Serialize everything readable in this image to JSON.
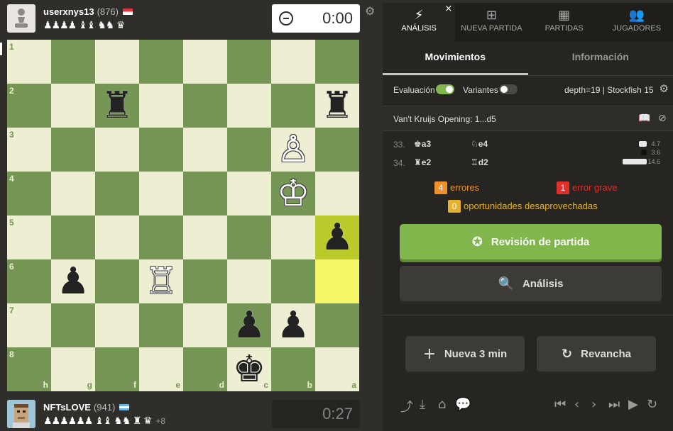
{
  "top_player": {
    "username": "userxnys13",
    "rating": "(876)",
    "country": "Indonesia",
    "captured": "♟♟♟♟ ♝♝ ♞♞ ♛",
    "clock": "0:00"
  },
  "bottom_player": {
    "username": "NFTsLOVE",
    "rating": "(941)",
    "country": "Argentina",
    "captured": "♟♟♟♟♟♟ ♝♝ ♞♞ ♜ ♛",
    "material_advantage": "+8",
    "clock": "0:27"
  },
  "board": {
    "orientation": "black",
    "ranks": [
      "1",
      "2",
      "3",
      "4",
      "5",
      "6",
      "7",
      "8"
    ],
    "files": [
      "h",
      "g",
      "f",
      "e",
      "d",
      "c",
      "b",
      "a"
    ],
    "highlighted": [
      "a5",
      "a6"
    ],
    "pieces": [
      {
        "square": "f2",
        "glyph": "♜",
        "color": "b"
      },
      {
        "square": "a2",
        "glyph": "♜",
        "color": "b"
      },
      {
        "square": "b3",
        "glyph": "♙",
        "color": "w"
      },
      {
        "square": "b4",
        "glyph": "♔",
        "color": "w"
      },
      {
        "square": "a5",
        "glyph": "♟",
        "color": "b"
      },
      {
        "square": "g6",
        "glyph": "♟",
        "color": "b"
      },
      {
        "square": "e6",
        "glyph": "♖",
        "color": "w"
      },
      {
        "square": "c7",
        "glyph": "♟",
        "color": "b"
      },
      {
        "square": "b7",
        "glyph": "♟",
        "color": "b"
      },
      {
        "square": "c8",
        "glyph": "♚",
        "color": "b"
      }
    ]
  },
  "tabs": [
    {
      "label": "ANÁLISIS",
      "icon": "lightning-icon",
      "glyph": "⚡",
      "active": true
    },
    {
      "label": "NUEVA PARTIDA",
      "icon": "plus-square-icon",
      "glyph": "⊞",
      "active": false
    },
    {
      "label": "PARTIDAS",
      "icon": "chessboard-icon",
      "glyph": "▦",
      "active": false
    },
    {
      "label": "JUGADORES",
      "icon": "players-icon",
      "glyph": "👥",
      "active": false
    }
  ],
  "subtabs": {
    "moves": "Movimientos",
    "info": "Información"
  },
  "options": {
    "evaluation_label": "Evaluación",
    "evaluation_on": true,
    "variants_label": "Variantes",
    "variants_on": false,
    "engine": "depth=19 |  Stockfish 15"
  },
  "opening": "Van't Kruijs Opening: 1...d5",
  "moves": [
    {
      "number": "33.",
      "white_piece": "♚",
      "white_sq": "a3",
      "black_piece": "♘",
      "black_sq": "e4",
      "time_white": "4.7",
      "time_black": "3.6"
    },
    {
      "number": "34.",
      "white_piece": "♜",
      "white_sq": "e2",
      "black_piece": "♖",
      "black_sq": "d2",
      "time_white": "14.6",
      "time_black": ""
    }
  ],
  "stats": {
    "errors_count": "4",
    "errors_label": "errores",
    "blunders_count": "1",
    "blunders_label": "error grave",
    "missed_count": "0",
    "missed_label": "oportunidades desaprovechadas"
  },
  "buttons": {
    "review": "Revisión de partida",
    "analysis": "Análisis",
    "new_game": "Nueva 3 min",
    "rematch": "Revancha"
  },
  "colors": {
    "light_square": "#eeeed2",
    "dark_square": "#769656",
    "accent_green": "#81b64c",
    "error_orange": "#f0902b",
    "blunder_red": "#e0302b",
    "missed_yellow": "#e5b22d"
  }
}
